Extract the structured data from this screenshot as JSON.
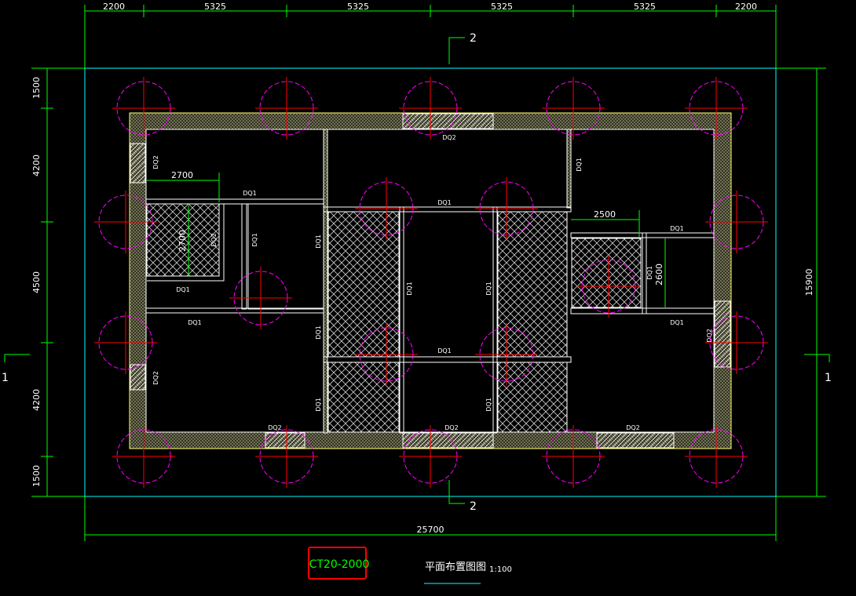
{
  "drawing": {
    "top_dims": [
      "2200",
      "5325",
      "5325",
      "5325",
      "5325",
      "2200"
    ],
    "left_dims": [
      "1500",
      "4200",
      "4500",
      "4200",
      "1500"
    ],
    "total_width": "25700",
    "total_height": "15900",
    "inner_dims": {
      "d1": "2700",
      "d2": "2700",
      "d3": "2500",
      "d4": "2600"
    },
    "door_labels": {
      "dq1": "DQ1",
      "dq2": "DQ2"
    },
    "section_labels": {
      "top": "2",
      "bottom": "2",
      "left": "1",
      "right": "1"
    }
  },
  "footer": {
    "tag": "CT20-2000",
    "title": "平面布置图图",
    "scale": "1:100"
  },
  "colors": {
    "background": "#000000",
    "dimension_line": "#00ff00",
    "border": "#00ffff",
    "wall": "#ffff66",
    "pile_circle": "#ff00ff",
    "axis_cross": "#ff0000",
    "hatch": "#ffffff",
    "tag_box": "#ff0000"
  }
}
